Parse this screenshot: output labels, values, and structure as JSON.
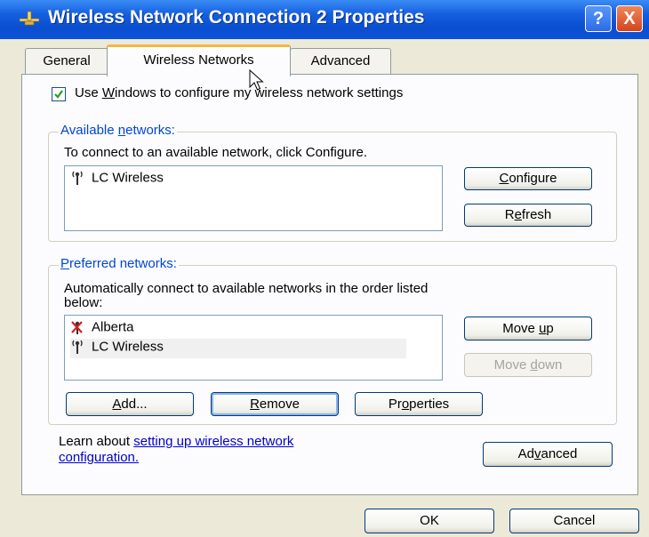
{
  "window": {
    "title": "Wireless Network Connection 2 Properties",
    "help_label": "?",
    "close_label": "X"
  },
  "tabs": [
    {
      "label": "General"
    },
    {
      "label": "Wireless Networks",
      "active": true
    },
    {
      "label": "Advanced"
    }
  ],
  "use_windows": {
    "checked": true,
    "pre": "Use ",
    "accel": "W",
    "post": "indows to configure my wireless network settings"
  },
  "available": {
    "group_pre": "Available ",
    "group_accel": "n",
    "group_post": "etworks:",
    "hint": "To connect to an available network, click Configure.",
    "items": [
      {
        "label": "LC Wireless",
        "icon": "wireless-antenna-icon"
      }
    ],
    "configure_accel": "C",
    "configure_rest": "onfigure",
    "refresh_pre": "R",
    "refresh_accel": "e",
    "refresh_post": "fresh"
  },
  "preferred": {
    "group_accel": "P",
    "group_rest": "referred networks:",
    "hint_line1": "Automatically connect to available networks in the order listed",
    "hint_line2": "below:",
    "items": [
      {
        "label": "Alberta",
        "icon": "wireless-disconnected-icon"
      },
      {
        "label": "LC Wireless",
        "icon": "wireless-antenna-icon"
      }
    ],
    "move_up_pre": "Move ",
    "move_up_accel": "u",
    "move_up_post": "p",
    "move_down_pre": "Move ",
    "move_down_accel": "d",
    "move_down_post": "own",
    "add_pre": "",
    "add_accel": "A",
    "add_post": "dd...",
    "remove_accel": "R",
    "remove_post": "emove",
    "properties_pre": "Pr",
    "properties_accel": "o",
    "properties_post": "perties"
  },
  "learn": {
    "text": "Learn about ",
    "link1": "setting up wireless network",
    "link2": "configuration."
  },
  "advanced_button": {
    "pre": "Ad",
    "accel": "v",
    "post": "anced"
  },
  "ok_label": "OK",
  "cancel_label": "Cancel"
}
